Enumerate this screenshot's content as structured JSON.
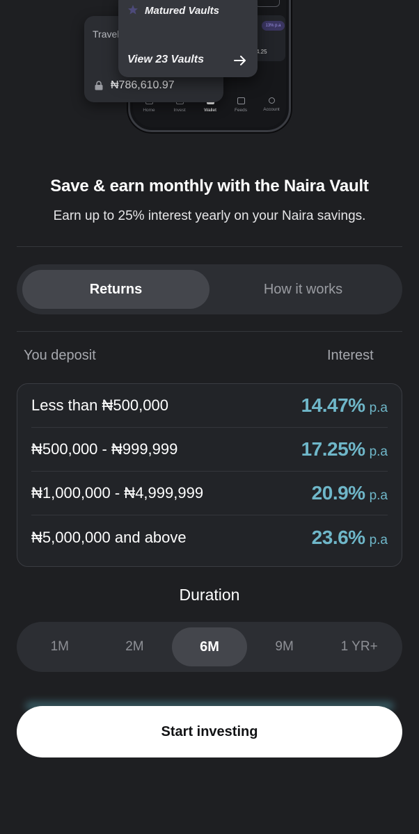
{
  "hero": {
    "matured_card": {
      "title": "Matured Vaults",
      "view_label": "View 23 Vaults"
    },
    "travel_card": {
      "title": "Travel",
      "amount": "₦786,610.97"
    },
    "phone": {
      "badge": "13% p.a",
      "amount_snippet": "4.25",
      "tabs": [
        "Home",
        "Invest",
        "Wallet",
        "Feeds",
        "Account"
      ],
      "active_tab": "Wallet"
    }
  },
  "heading": {
    "title": "Save & earn monthly with the Naira Vault",
    "subtitle": "Earn up to 25% interest yearly on your Naira savings."
  },
  "segmented": {
    "tabs": [
      "Returns",
      "How it works"
    ],
    "active": "Returns"
  },
  "rates": {
    "col_left": "You deposit",
    "col_right": "Interest",
    "rows": [
      {
        "label": "Less than ₦500,000",
        "rate": "14.47%",
        "unit": "p.a"
      },
      {
        "label": "₦500,000 - ₦999,999",
        "rate": "17.25%",
        "unit": "p.a"
      },
      {
        "label": "₦1,000,000 - ₦4,999,999",
        "rate": "20.9%",
        "unit": "p.a"
      },
      {
        "label": "₦5,000,000 and above",
        "rate": "23.6%",
        "unit": "p.a"
      }
    ]
  },
  "duration": {
    "title": "Duration",
    "options": [
      "1M",
      "2M",
      "6M",
      "9M",
      "1 YR+"
    ],
    "selected": "6M"
  },
  "cta": {
    "label": "Start investing"
  },
  "colors": {
    "background": "#1e1f22",
    "accent_rate": "#6fb7c9",
    "pill_bg": "#2c2e33",
    "pill_active": "#44464c"
  }
}
